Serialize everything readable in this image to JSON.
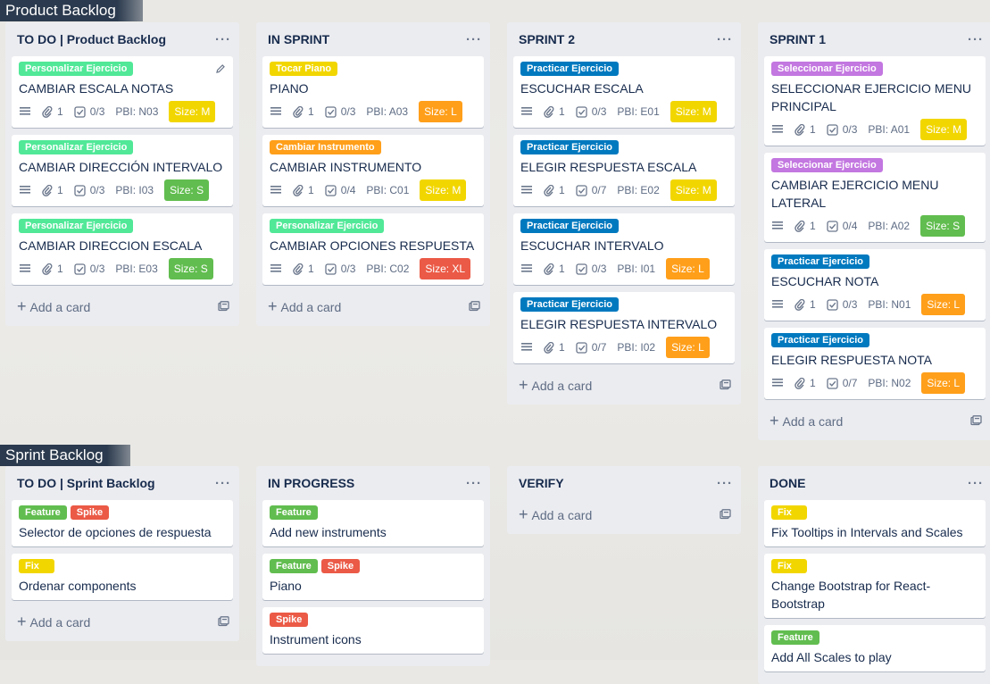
{
  "sections": [
    {
      "title": "Product Backlog",
      "lists": [
        {
          "title": "TO DO | Product Backlog",
          "menu": "···",
          "cards": [
            {
              "labels": [
                {
                  "text": "Personalizar Ejercicio",
                  "color": "#51e898"
                }
              ],
              "title": "CAMBIAR ESCALA NOTAS",
              "attachments": "1",
              "checklist": "0/3",
              "pbi": "PBI: N03",
              "size": "Size: M",
              "size_color": "#f2d600",
              "editing": true
            },
            {
              "labels": [
                {
                  "text": "Personalizar Ejercicio",
                  "color": "#51e898"
                }
              ],
              "title": "CAMBIAR DIRECCIÓN INTERVALO",
              "attachments": "1",
              "checklist": "0/3",
              "pbi": "PBI: I03",
              "size": "Size: S",
              "size_color": "#61bd4f"
            },
            {
              "labels": [
                {
                  "text": "Personalizar Ejercicio",
                  "color": "#51e898"
                }
              ],
              "title": "CAMBIAR DIRECCION ESCALA",
              "attachments": "1",
              "checklist": "0/3",
              "pbi": "PBI: E03",
              "size": "Size: S",
              "size_color": "#61bd4f"
            }
          ],
          "add": "Add a card"
        },
        {
          "title": "IN SPRINT",
          "menu": "···",
          "cards": [
            {
              "labels": [
                {
                  "text": "Tocar Piano",
                  "color": "#f2d600"
                }
              ],
              "title": "PIANO",
              "attachments": "1",
              "checklist": "0/3",
              "pbi": "PBI: A03",
              "size": "Size: L",
              "size_color": "#ff9f1a"
            },
            {
              "labels": [
                {
                  "text": "Cambiar Instrumento",
                  "color": "#ff9f1a"
                }
              ],
              "title": "CAMBIAR INSTRUMENTO",
              "attachments": "1",
              "checklist": "0/4",
              "pbi": "PBI: C01",
              "size": "Size: M",
              "size_color": "#f2d600"
            },
            {
              "labels": [
                {
                  "text": "Personalizar Ejercicio",
                  "color": "#51e898"
                }
              ],
              "title": "CAMBIAR OPCIONES RESPUESTA",
              "attachments": "1",
              "checklist": "0/3",
              "pbi": "PBI: C02",
              "size": "Size: XL",
              "size_color": "#eb5a46"
            }
          ],
          "add": "Add a card"
        },
        {
          "title": "SPRINT 2",
          "menu": "···",
          "cards": [
            {
              "labels": [
                {
                  "text": "Practicar Ejercicio",
                  "color": "#0079bf"
                }
              ],
              "title": "ESCUCHAR ESCALA",
              "attachments": "1",
              "checklist": "0/3",
              "pbi": "PBI: E01",
              "size": "Size: M",
              "size_color": "#f2d600"
            },
            {
              "labels": [
                {
                  "text": "Practicar Ejercicio",
                  "color": "#0079bf"
                }
              ],
              "title": "ELEGIR RESPUESTA ESCALA",
              "attachments": "1",
              "checklist": "0/7",
              "pbi": "PBI: E02",
              "size": "Size: M",
              "size_color": "#f2d600"
            },
            {
              "labels": [
                {
                  "text": "Practicar Ejercicio",
                  "color": "#0079bf"
                }
              ],
              "title": "ESCUCHAR INTERVALO",
              "attachments": "1",
              "checklist": "0/3",
              "pbi": "PBI: I01",
              "size": "Size: L",
              "size_color": "#ff9f1a"
            },
            {
              "labels": [
                {
                  "text": "Practicar Ejercicio",
                  "color": "#0079bf"
                }
              ],
              "title": "ELEGIR RESPUESTA INTERVALO",
              "attachments": "1",
              "checklist": "0/7",
              "pbi": "PBI: I02",
              "size": "Size: L",
              "size_color": "#ff9f1a"
            }
          ],
          "add": "Add a card"
        },
        {
          "title": "SPRINT 1",
          "menu": "···",
          "cards": [
            {
              "labels": [
                {
                  "text": "Seleccionar Ejercicio",
                  "color": "#c377e0"
                }
              ],
              "title": "SELECCIONAR EJERCICIO MENU PRINCIPAL",
              "attachments": "1",
              "checklist": "0/3",
              "pbi": "PBI: A01",
              "size": "Size: M",
              "size_color": "#f2d600"
            },
            {
              "labels": [
                {
                  "text": "Seleccionar Ejercicio",
                  "color": "#c377e0"
                }
              ],
              "title": "CAMBIAR EJERCICIO MENU LATERAL",
              "attachments": "1",
              "checklist": "0/4",
              "pbi": "PBI: A02",
              "size": "Size: S",
              "size_color": "#61bd4f"
            },
            {
              "labels": [
                {
                  "text": "Practicar Ejercicio",
                  "color": "#0079bf"
                }
              ],
              "title": "ESCUCHAR NOTA",
              "attachments": "1",
              "checklist": "0/3",
              "pbi": "PBI: N01",
              "size": "Size: L",
              "size_color": "#ff9f1a"
            },
            {
              "labels": [
                {
                  "text": "Practicar Ejercicio",
                  "color": "#0079bf"
                }
              ],
              "title": "ELEGIR RESPUESTA NOTA",
              "attachments": "1",
              "checklist": "0/7",
              "pbi": "PBI: N02",
              "size": "Size: L",
              "size_color": "#ff9f1a"
            }
          ],
          "add": "Add a card"
        }
      ]
    },
    {
      "title": "Sprint Backlog",
      "lists": [
        {
          "title": "TO DO | Sprint Backlog",
          "menu": "···",
          "cards": [
            {
              "labels": [
                {
                  "text": "Feature",
                  "color": "#61bd4f"
                },
                {
                  "text": "Spike",
                  "color": "#eb5a46"
                }
              ],
              "title": "Selector de opciones de respuesta"
            },
            {
              "labels": [
                {
                  "text": "Fix",
                  "color": "#f2d600"
                }
              ],
              "title": "Ordenar components"
            }
          ],
          "add": "Add a card"
        },
        {
          "title": "IN PROGRESS",
          "menu": "···",
          "cards": [
            {
              "labels": [
                {
                  "text": "Feature",
                  "color": "#61bd4f"
                }
              ],
              "title": "Add new instruments"
            },
            {
              "labels": [
                {
                  "text": "Feature",
                  "color": "#61bd4f"
                },
                {
                  "text": "Spike",
                  "color": "#eb5a46"
                }
              ],
              "title": "Piano"
            },
            {
              "labels": [
                {
                  "text": "Spike",
                  "color": "#eb5a46"
                }
              ],
              "title": "Instrument icons"
            }
          ],
          "add": ""
        },
        {
          "title": "VERIFY",
          "menu": "···",
          "cards": [],
          "add": "Add a card"
        },
        {
          "title": "DONE",
          "menu": "···",
          "cards": [
            {
              "labels": [
                {
                  "text": "Fix",
                  "color": "#f2d600"
                }
              ],
              "title": "Fix Tooltips in Intervals and Scales"
            },
            {
              "labels": [
                {
                  "text": "Fix",
                  "color": "#f2d600"
                }
              ],
              "title": "Change Bootstrap for React-Bootstrap"
            },
            {
              "labels": [
                {
                  "text": "Feature",
                  "color": "#61bd4f"
                }
              ],
              "title": "Add All Scales to play"
            }
          ],
          "add": ""
        }
      ]
    }
  ]
}
